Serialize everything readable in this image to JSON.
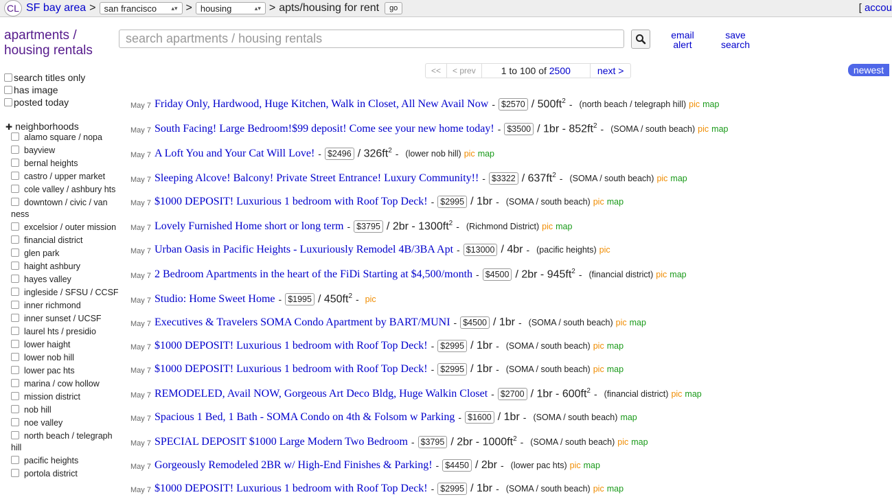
{
  "header": {
    "logo": "CL",
    "area": "SF bay area",
    "area_select": "san francisco",
    "category_select": "housing",
    "subcategory": "apts/housing for rent",
    "go_label": "go",
    "account": "accou"
  },
  "sidebar": {
    "title_line1": "apartments /",
    "title_line2": "housing rentals",
    "filters": [
      "search titles only",
      "has image",
      "posted today"
    ],
    "neighborhoods_label": "neighborhoods",
    "neighborhoods": [
      "alamo square / nopa",
      "bayview",
      "bernal heights",
      "castro / upper market",
      "cole valley / ashbury hts",
      "downtown / civic / van ness",
      "excelsior / outer mission",
      "financial district",
      "glen park",
      "haight ashbury",
      "hayes valley",
      "ingleside / SFSU / CCSF",
      "inner richmond",
      "inner sunset / UCSF",
      "laurel hts / presidio",
      "lower haight",
      "lower nob hill",
      "lower pac hts",
      "marina / cow hollow",
      "mission district",
      "nob hill",
      "noe valley",
      "north beach / telegraph hill",
      "pacific heights",
      "portola district"
    ]
  },
  "search": {
    "placeholder": "search apartments / housing rentals",
    "email_alert_1": "email",
    "email_alert_2": "alert",
    "save_search_1": "save",
    "save_search_2": "search"
  },
  "pager": {
    "first": "<<",
    "prev": "< prev",
    "range": "1 to 100 of ",
    "total": "2500",
    "next": "next >",
    "sort": "newest"
  },
  "listings": [
    {
      "date": "May 7",
      "title": "Friday Only, Hardwood, Huge Kitchen, Walk in Closet, All New Avail Now",
      "price": "$2570",
      "housing": "/ 500ft",
      "sqft": true,
      "hood": "(north beach / telegraph hill)",
      "pic": "pic",
      "map": "map"
    },
    {
      "date": "May 7",
      "title": "South Facing! Large Bedroom!$99 deposit! Come see your new home today!",
      "price": "$3500",
      "housing": "/ 1br - 852ft",
      "sqft": true,
      "hood": "(SOMA / south beach)",
      "pic": "pic",
      "map": "map"
    },
    {
      "date": "May 7",
      "title": "A Loft You and Your Cat Will Love!",
      "price": "$2496",
      "housing": "/ 326ft",
      "sqft": true,
      "hood": "(lower nob hill)",
      "pic": "pic",
      "map": "map"
    },
    {
      "date": "May 7",
      "title": "Sleeping Alcove! Balcony! Private Street Entrance! Luxury Community!!",
      "price": "$3322",
      "housing": "/ 637ft",
      "sqft": true,
      "hood": "(SOMA / south beach)",
      "pic": "pic",
      "map": "map"
    },
    {
      "date": "May 7",
      "title": "$1000 DEPOSIT! Luxurious 1 bedroom with Roof Top Deck!",
      "price": "$2995",
      "housing": "/ 1br",
      "sqft": false,
      "hood": "(SOMA / south beach)",
      "pic": "pic",
      "map": "map"
    },
    {
      "date": "May 7",
      "title": "Lovely Furnished Home short or long term",
      "price": "$3795",
      "housing": "/ 2br - 1300ft",
      "sqft": true,
      "hood": "(Richmond District)",
      "pic": "pic",
      "map": "map"
    },
    {
      "date": "May 7",
      "title": "Urban Oasis in Pacific Heights - Luxuriously Remodel 4B/3BA Apt",
      "price": "$13000",
      "housing": "/ 4br",
      "sqft": false,
      "hood": "(pacific heights)",
      "pic": "pic",
      "map": ""
    },
    {
      "date": "May 7",
      "title": "2 Bedroom Apartments in the heart of the FiDi Starting at $4,500/month",
      "price": "$4500",
      "housing": "/ 2br - 945ft",
      "sqft": true,
      "hood": "(financial district)",
      "pic": "pic",
      "map": "map"
    },
    {
      "date": "May 7",
      "title": "Studio: Home Sweet Home",
      "price": "$1995",
      "housing": "/ 450ft",
      "sqft": true,
      "hood": "",
      "pic": "pic",
      "map": ""
    },
    {
      "date": "May 7",
      "title": "Executives & Travelers SOMA Condo Apartment by BART/MUNI",
      "price": "$4500",
      "housing": "/ 1br",
      "sqft": false,
      "hood": "(SOMA / south beach)",
      "pic": "pic",
      "map": "map"
    },
    {
      "date": "May 7",
      "title": "$1000 DEPOSIT! Luxurious 1 bedroom with Roof Top Deck!",
      "price": "$2995",
      "housing": "/ 1br",
      "sqft": false,
      "hood": "(SOMA / south beach)",
      "pic": "pic",
      "map": "map"
    },
    {
      "date": "May 7",
      "title": "$1000 DEPOSIT! Luxurious 1 bedroom with Roof Top Deck!",
      "price": "$2995",
      "housing": "/ 1br",
      "sqft": false,
      "hood": "(SOMA / south beach)",
      "pic": "pic",
      "map": "map"
    },
    {
      "date": "May 7",
      "title": "REMODELED, Avail NOW, Gorgeous Art Deco Bldg, Huge Walkin Closet",
      "price": "$2700",
      "housing": "/ 1br - 600ft",
      "sqft": true,
      "hood": "(financial district)",
      "pic": "pic",
      "map": "map"
    },
    {
      "date": "May 7",
      "title": "Spacious 1 Bed, 1 Bath - SOMA Condo on 4th & Folsom w Parking",
      "price": "$1600",
      "housing": "/ 1br",
      "sqft": false,
      "hood": "(SOMA / south beach)",
      "pic": "",
      "map": "map"
    },
    {
      "date": "May 7",
      "title": "SPECIAL DEPOSIT $1000 Large Modern Two Bedroom",
      "price": "$3795",
      "housing": "/ 2br - 1000ft",
      "sqft": true,
      "hood": "(SOMA / south beach)",
      "pic": "pic",
      "map": "map"
    },
    {
      "date": "May 7",
      "title": "Gorgeously Remodeled 2BR w/ High-End Finishes & Parking!",
      "price": "$4450",
      "housing": "/ 2br",
      "sqft": false,
      "hood": "(lower pac hts)",
      "pic": "pic",
      "map": "map"
    },
    {
      "date": "May 7",
      "title": "$1000 DEPOSIT! Luxurious 1 bedroom with Roof Top Deck!",
      "price": "$2995",
      "housing": "/ 1br",
      "sqft": false,
      "hood": "(SOMA / south beach)",
      "pic": "pic",
      "map": "map"
    }
  ]
}
